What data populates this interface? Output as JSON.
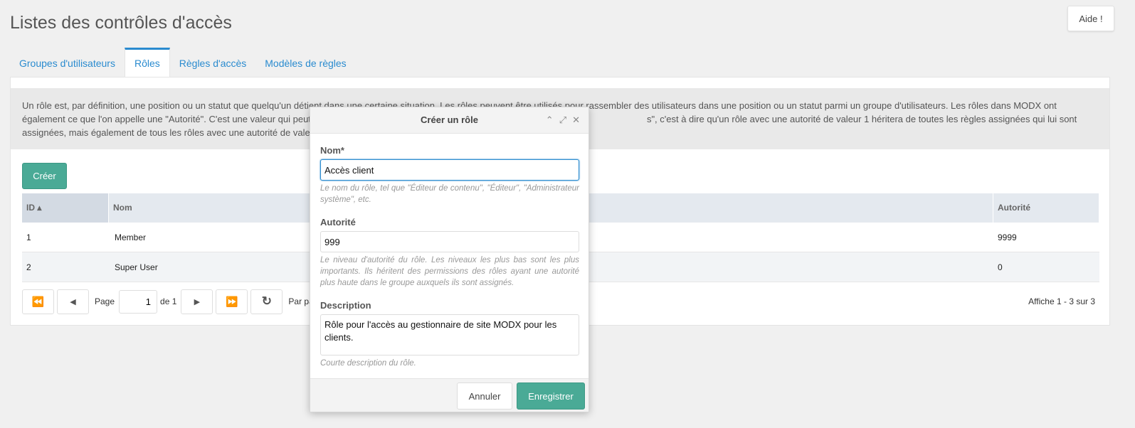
{
  "page": {
    "title": "Listes des contrôles d'accès",
    "help_label": "Aide !"
  },
  "tabs": [
    {
      "label": "Groupes d'utilisateurs",
      "active": false
    },
    {
      "label": "Rôles",
      "active": true
    },
    {
      "label": "Règles d'accès",
      "active": false
    },
    {
      "label": "Modèles de règles",
      "active": false
    }
  ],
  "description": {
    "text": "Un rôle est, par définition, une position ou un statut que quelqu'un détient dans une certaine situation. Les rôles peuvent être utilisés pour rassembler des utilisateurs dans une position ou un statut parmi un groupe d'utilisateurs. Les rôles dans MODX ont également ce que l'on appelle une \"Autorité\". C'est une valeur qui peut être n'impo                                                                                                                s\", c'est à dire qu'un rôle avec une autorité de valeur 1 héritera de toutes les règles assignées qui lui sont assignées, mais également de tous les rôles avec une autorité de valeur supérieure à 1."
  },
  "toolbar": {
    "create_label": "Créer"
  },
  "grid": {
    "columns": {
      "id": "ID ▴",
      "name": "Nom",
      "authority": "Autorité"
    },
    "rows": [
      {
        "id": "1",
        "name": "Member",
        "authority": "9999"
      },
      {
        "id": "2",
        "name": "Super User",
        "authority": "0"
      }
    ]
  },
  "pager": {
    "first_icon": "⏪",
    "prev_icon": "◀",
    "next_icon": "▶",
    "last_icon": "⏩",
    "refresh_icon": "↻",
    "page_label": "Page",
    "page_value": "1",
    "of_label": "de 1",
    "per_page_label": "Par pag",
    "info": "Affiche 1 - 3 sur 3"
  },
  "modal": {
    "title": "Créer un rôle",
    "tools": {
      "collapse": "⌃",
      "maximize": "⤢",
      "close": "✕"
    },
    "name_label": "Nom*",
    "name_value": "Accès client",
    "name_help": "Le nom du rôle, tel que \"Éditeur de contenu\", \"Éditeur\", \"Administrateur système\", etc.",
    "authority_label": "Autorité",
    "authority_value": "999",
    "authority_help": "Le niveau d'autorité du rôle. Les niveaux les plus bas sont les plus importants. Ils héritent des permissions des rôles ayant une autorité plus haute dans le groupe auxquels ils sont assignés.",
    "description_label": "Description",
    "description_value": "Rôle pour l'accès au gestionnaire de site MODX pour les clients.",
    "description_help": "Courte description du rôle.",
    "cancel_label": "Annuler",
    "save_label": "Enregistrer"
  }
}
